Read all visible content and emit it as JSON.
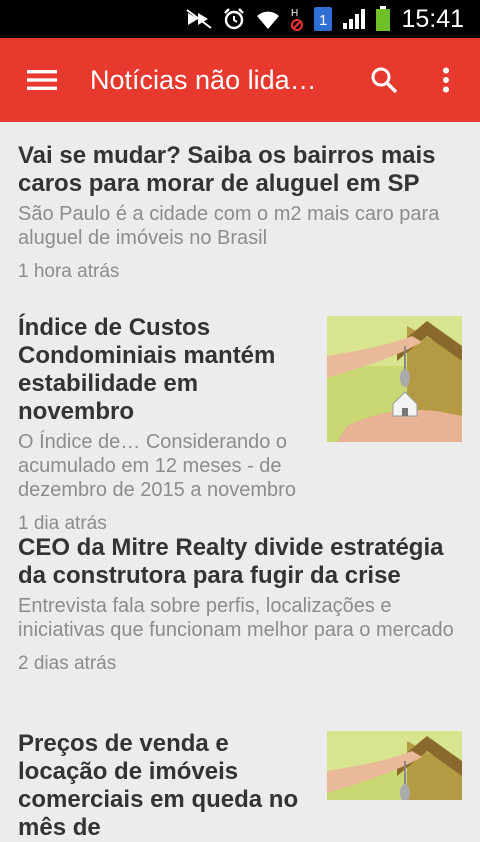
{
  "status_bar": {
    "time": "15:41",
    "notification_badge": "1",
    "icons": [
      "silent-mode-icon",
      "alarm-icon",
      "wifi-icon",
      "hd-icon",
      "notification-badge-icon",
      "signal-icon",
      "battery-icon"
    ]
  },
  "app_bar": {
    "title": "Notícias não lida…",
    "icons": [
      "menu-icon",
      "search-icon",
      "more-vert-icon"
    ],
    "color": "#e8392f"
  },
  "articles": [
    {
      "title": "Vai se mudar? Saiba os bairros mais caros para morar de aluguel em SP",
      "summary": "São Paulo é a cidade com o m2 mais caro para aluguel de imóveis no Brasil",
      "time": "1 hora atrás"
    },
    {
      "title": "Índice de Custos Condominiais mantém estabilidade em novembro",
      "summary": "O Índice de… Considerando o acumulado em 12 meses - de dezembro de 2015 a novembro",
      "time": "1 dia atrás"
    },
    {
      "title": "CEO da Mitre Realty divide estratégia da construtora para fugir da crise",
      "summary": "Entrevista fala sobre perfis, localizações e iniciativas que funcionam melhor para o mercado",
      "time": "2 dias atrás"
    },
    {
      "title": "Preços de venda e locação de imóveis comerciais em queda no mês de",
      "summary": "",
      "time": ""
    }
  ]
}
